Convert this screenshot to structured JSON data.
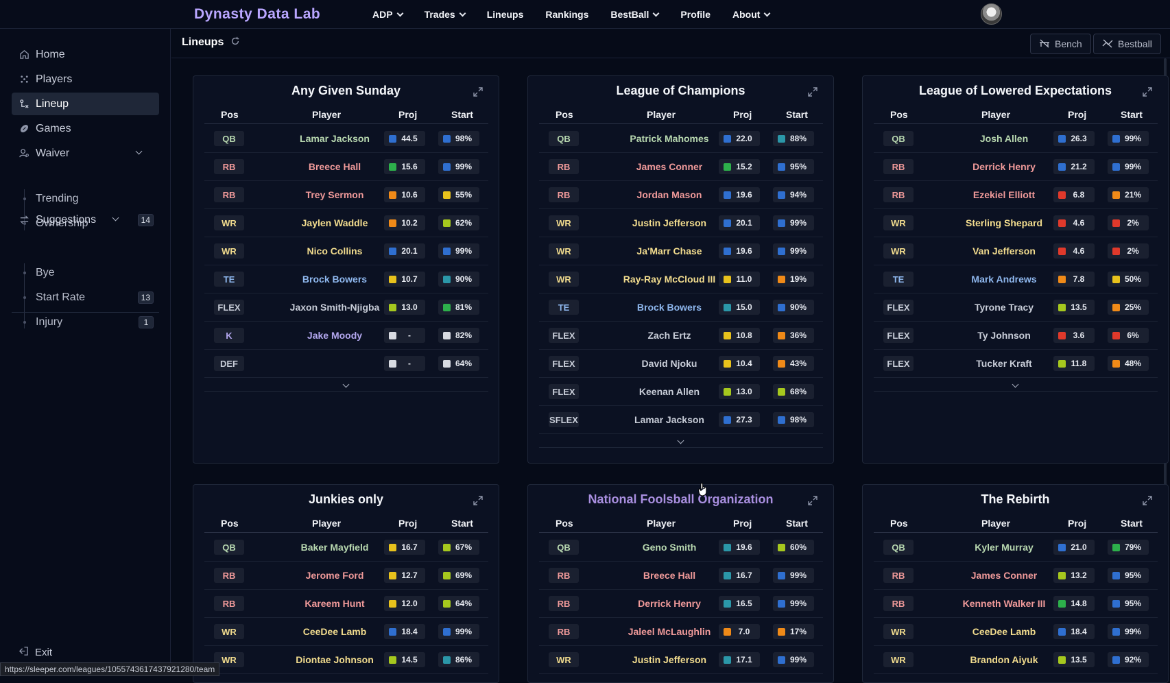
{
  "brand": "Dynasty Data Lab",
  "nav": [
    {
      "label": "ADP",
      "dropdown": true
    },
    {
      "label": "Trades",
      "dropdown": true
    },
    {
      "label": "Lineups",
      "dropdown": false
    },
    {
      "label": "Rankings",
      "dropdown": false
    },
    {
      "label": "BestBall",
      "dropdown": true
    },
    {
      "label": "Profile",
      "dropdown": false
    },
    {
      "label": "About",
      "dropdown": true
    }
  ],
  "sidebar": {
    "home": "Home",
    "players": "Players",
    "lineup": "Lineup",
    "games": "Games",
    "waiver": "Waiver",
    "trending": "Trending",
    "ownership": "Ownership",
    "suggestions": "Suggestions",
    "suggestions_count": "14",
    "bye": "Bye",
    "start_rate": "Start Rate",
    "start_rate_count": "13",
    "injury": "Injury",
    "injury_count": "1",
    "exit": "Exit"
  },
  "header": {
    "title": "Lineups",
    "bench": "Bench",
    "bestball": "Bestball"
  },
  "status_url": "https://sleeper.com/leagues/1055743617437921280/team",
  "columns": {
    "pos": "Pos",
    "player": "Player",
    "proj": "Proj",
    "start": "Start"
  },
  "colors": {
    "blue": "#2f6fd0",
    "teal": "#2b97a8",
    "green": "#2db04b",
    "lime": "#a6c81e",
    "yellow": "#e8c21c",
    "orange": "#f08a18",
    "red": "#e0392b",
    "gray": "#d8dbe2"
  },
  "leagues": [
    {
      "name": "Any Given Sunday",
      "rows": [
        {
          "pos": "QB",
          "player": "Lamar Jackson",
          "proj": "44.5",
          "pc": "blue",
          "start": "98%",
          "sc": "blue"
        },
        {
          "pos": "RB",
          "player": "Breece Hall",
          "proj": "15.6",
          "pc": "green",
          "start": "99%",
          "sc": "blue"
        },
        {
          "pos": "RB",
          "player": "Trey Sermon",
          "proj": "10.6",
          "pc": "orange",
          "start": "55%",
          "sc": "yellow"
        },
        {
          "pos": "WR",
          "player": "Jaylen Waddle",
          "proj": "10.2",
          "pc": "orange",
          "start": "62%",
          "sc": "lime"
        },
        {
          "pos": "WR",
          "player": "Nico Collins",
          "proj": "20.1",
          "pc": "blue",
          "start": "99%",
          "sc": "blue"
        },
        {
          "pos": "TE",
          "player": "Brock Bowers",
          "proj": "10.7",
          "pc": "yellow",
          "start": "90%",
          "sc": "teal"
        },
        {
          "pos": "FLEX",
          "player": "Jaxon Smith-Njigba",
          "proj": "13.0",
          "pc": "lime",
          "start": "81%",
          "sc": "green"
        },
        {
          "pos": "K",
          "player": "Jake Moody",
          "proj": "-",
          "pc": "gray",
          "start": "82%",
          "sc": "gray"
        },
        {
          "pos": "DEF",
          "player": "",
          "proj": "-",
          "pc": "gray",
          "start": "64%",
          "sc": "gray"
        }
      ]
    },
    {
      "name": "League of Champions",
      "rows": [
        {
          "pos": "QB",
          "player": "Patrick Mahomes",
          "proj": "22.0",
          "pc": "blue",
          "start": "88%",
          "sc": "teal"
        },
        {
          "pos": "RB",
          "player": "James Conner",
          "proj": "15.2",
          "pc": "green",
          "start": "95%",
          "sc": "blue"
        },
        {
          "pos": "RB",
          "player": "Jordan Mason",
          "proj": "19.6",
          "pc": "blue",
          "start": "94%",
          "sc": "blue"
        },
        {
          "pos": "WR",
          "player": "Justin Jefferson",
          "proj": "20.1",
          "pc": "blue",
          "start": "99%",
          "sc": "blue"
        },
        {
          "pos": "WR",
          "player": "Ja'Marr Chase",
          "proj": "19.6",
          "pc": "blue",
          "start": "99%",
          "sc": "blue"
        },
        {
          "pos": "WR",
          "player": "Ray-Ray McCloud III",
          "proj": "11.0",
          "pc": "yellow",
          "start": "19%",
          "sc": "orange"
        },
        {
          "pos": "TE",
          "player": "Brock Bowers",
          "proj": "15.0",
          "pc": "teal",
          "start": "90%",
          "sc": "blue"
        },
        {
          "pos": "FLEX",
          "player": "Zach Ertz",
          "proj": "10.8",
          "pc": "yellow",
          "start": "36%",
          "sc": "orange"
        },
        {
          "pos": "FLEX",
          "player": "David Njoku",
          "proj": "10.4",
          "pc": "yellow",
          "start": "43%",
          "sc": "orange"
        },
        {
          "pos": "FLEX",
          "player": "Keenan Allen",
          "proj": "13.0",
          "pc": "lime",
          "start": "68%",
          "sc": "lime"
        },
        {
          "pos": "SFLEX",
          "player": "Lamar Jackson",
          "proj": "27.3",
          "pc": "blue",
          "start": "98%",
          "sc": "blue"
        }
      ]
    },
    {
      "name": "League of Lowered Expectations",
      "rows": [
        {
          "pos": "QB",
          "player": "Josh Allen",
          "proj": "26.3",
          "pc": "blue",
          "start": "99%",
          "sc": "blue"
        },
        {
          "pos": "RB",
          "player": "Derrick Henry",
          "proj": "21.2",
          "pc": "blue",
          "start": "99%",
          "sc": "blue"
        },
        {
          "pos": "RB",
          "player": "Ezekiel Elliott",
          "proj": "6.8",
          "pc": "red",
          "start": "21%",
          "sc": "orange"
        },
        {
          "pos": "WR",
          "player": "Sterling Shepard",
          "proj": "4.6",
          "pc": "red",
          "start": "2%",
          "sc": "red"
        },
        {
          "pos": "WR",
          "player": "Van Jefferson",
          "proj": "4.6",
          "pc": "red",
          "start": "2%",
          "sc": "red"
        },
        {
          "pos": "TE",
          "player": "Mark Andrews",
          "proj": "7.8",
          "pc": "orange",
          "start": "50%",
          "sc": "yellow"
        },
        {
          "pos": "FLEX",
          "player": "Tyrone Tracy",
          "proj": "13.5",
          "pc": "lime",
          "start": "25%",
          "sc": "orange"
        },
        {
          "pos": "FLEX",
          "player": "Ty Johnson",
          "proj": "3.6",
          "pc": "red",
          "start": "6%",
          "sc": "red"
        },
        {
          "pos": "FLEX",
          "player": "Tucker Kraft",
          "proj": "11.8",
          "pc": "lime",
          "start": "48%",
          "sc": "orange"
        }
      ]
    },
    {
      "name": "Junkies only",
      "rows": [
        {
          "pos": "QB",
          "player": "Baker Mayfield",
          "proj": "16.7",
          "pc": "yellow",
          "start": "67%",
          "sc": "lime"
        },
        {
          "pos": "RB",
          "player": "Jerome Ford",
          "proj": "12.7",
          "pc": "yellow",
          "start": "69%",
          "sc": "lime"
        },
        {
          "pos": "RB",
          "player": "Kareem Hunt",
          "proj": "12.0",
          "pc": "yellow",
          "start": "64%",
          "sc": "lime"
        },
        {
          "pos": "WR",
          "player": "CeeDee Lamb",
          "proj": "18.4",
          "pc": "blue",
          "start": "99%",
          "sc": "blue"
        },
        {
          "pos": "WR",
          "player": "Diontae Johnson",
          "proj": "14.5",
          "pc": "lime",
          "start": "86%",
          "sc": "teal"
        }
      ]
    },
    {
      "name": "National Foolsball Organization",
      "rows": [
        {
          "pos": "QB",
          "player": "Geno Smith",
          "proj": "19.6",
          "pc": "teal",
          "start": "60%",
          "sc": "lime"
        },
        {
          "pos": "RB",
          "player": "Breece Hall",
          "proj": "16.7",
          "pc": "teal",
          "start": "99%",
          "sc": "blue"
        },
        {
          "pos": "RB",
          "player": "Derrick Henry",
          "proj": "16.5",
          "pc": "teal",
          "start": "99%",
          "sc": "blue"
        },
        {
          "pos": "RB",
          "player": "Jaleel McLaughlin",
          "proj": "7.0",
          "pc": "orange",
          "start": "17%",
          "sc": "orange"
        },
        {
          "pos": "WR",
          "player": "Justin Jefferson",
          "proj": "17.1",
          "pc": "teal",
          "start": "99%",
          "sc": "blue"
        }
      ]
    },
    {
      "name": "The Rebirth",
      "rows": [
        {
          "pos": "QB",
          "player": "Kyler Murray",
          "proj": "21.0",
          "pc": "blue",
          "start": "79%",
          "sc": "green"
        },
        {
          "pos": "RB",
          "player": "James Conner",
          "proj": "13.2",
          "pc": "lime",
          "start": "95%",
          "sc": "blue"
        },
        {
          "pos": "RB",
          "player": "Kenneth Walker III",
          "proj": "14.8",
          "pc": "green",
          "start": "95%",
          "sc": "blue"
        },
        {
          "pos": "WR",
          "player": "CeeDee Lamb",
          "proj": "18.4",
          "pc": "blue",
          "start": "99%",
          "sc": "blue"
        },
        {
          "pos": "WR",
          "player": "Brandon Aiyuk",
          "proj": "13.5",
          "pc": "lime",
          "start": "92%",
          "sc": "blue"
        }
      ]
    }
  ]
}
